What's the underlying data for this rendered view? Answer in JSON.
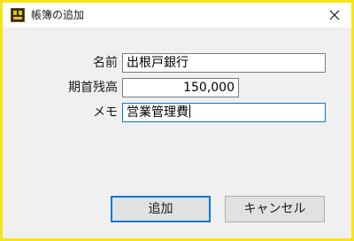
{
  "window": {
    "title": "帳簿の追加",
    "app_icon": "ledger-app-icon",
    "close_icon": "close-x-icon"
  },
  "form": {
    "name_label": "名前",
    "name_value": "出根戸銀行",
    "balance_label": "期首残高",
    "balance_value": "150,000",
    "memo_label": "メモ",
    "memo_value": "営業管理費"
  },
  "buttons": {
    "add_label": "追加",
    "cancel_label": "キャンセル"
  },
  "colors": {
    "frame": "#f8e414",
    "accent": "#0078d7"
  }
}
